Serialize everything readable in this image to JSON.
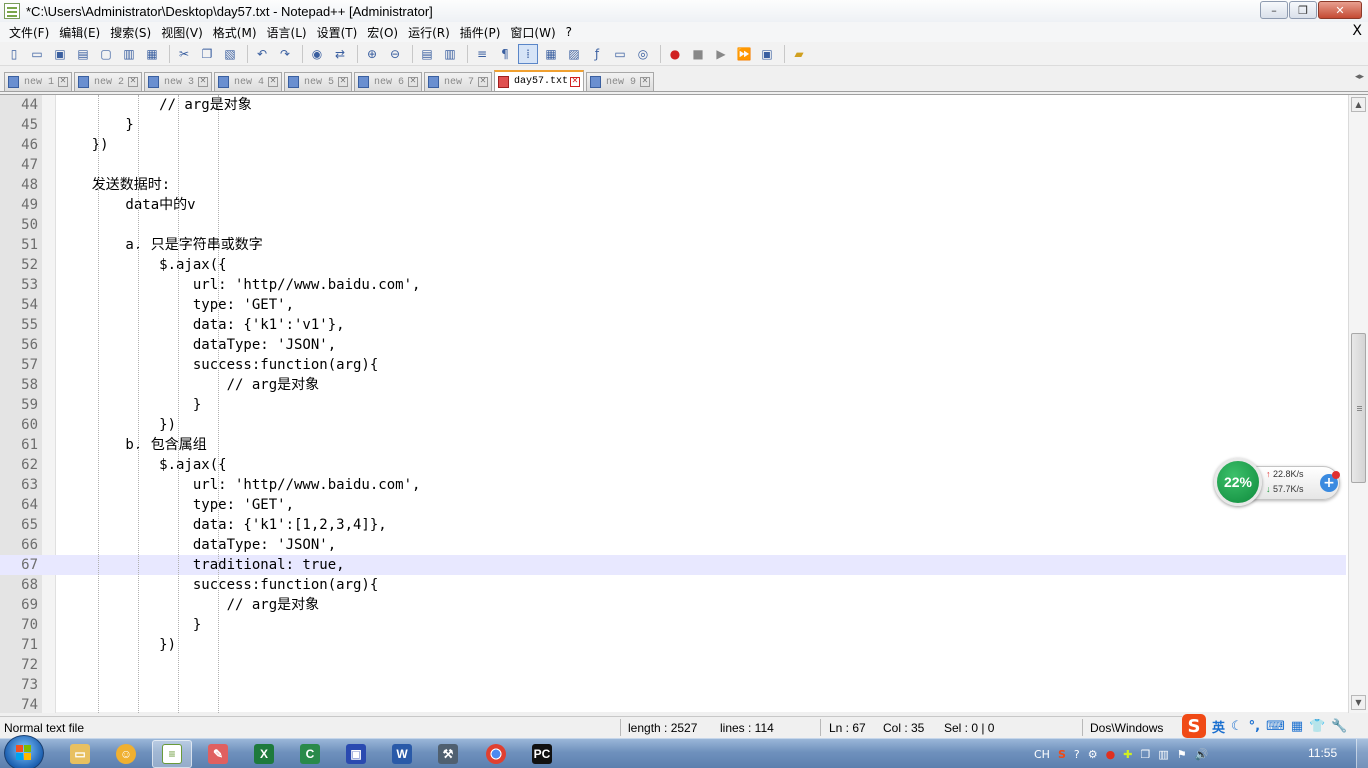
{
  "window": {
    "title": "*C:\\Users\\Administrator\\Desktop\\day57.txt - Notepad++ [Administrator]",
    "minimize_label": "–",
    "restore_label": "❐",
    "close_label": "✕"
  },
  "menu": {
    "items": [
      "文件(F)",
      "编辑(E)",
      "搜索(S)",
      "视图(V)",
      "格式(M)",
      "语言(L)",
      "设置(T)",
      "宏(O)",
      "运行(R)",
      "插件(P)",
      "窗口(W)",
      "?"
    ],
    "close_label": "X"
  },
  "toolbar": {
    "icons": [
      "new-file-icon",
      "open-file-icon",
      "save-icon",
      "save-all-icon",
      "close-file-icon",
      "close-all-icon",
      "print-icon",
      "cut-icon",
      "copy-icon",
      "paste-icon",
      "undo-icon",
      "redo-icon",
      "find-icon",
      "replace-icon",
      "zoom-in-icon",
      "zoom-out-icon",
      "sync-v-icon",
      "sync-h-icon",
      "word-wrap-icon",
      "show-all-chars-icon",
      "indent-guide-icon",
      "udl-icon",
      "doc-map-icon",
      "function-list-icon",
      "folder-workspace-icon",
      "monitor-icon",
      "record-macro-icon",
      "stop-record-icon",
      "play-macro-icon",
      "run-macro-multiple-icon",
      "save-macro-icon",
      "plugin-icon"
    ]
  },
  "tabs": [
    {
      "label": "new 1",
      "active": false
    },
    {
      "label": "new 2",
      "active": false
    },
    {
      "label": "new 3",
      "active": false
    },
    {
      "label": "new 4",
      "active": false
    },
    {
      "label": "new 5",
      "active": false
    },
    {
      "label": "new 6",
      "active": false
    },
    {
      "label": "new 7",
      "active": false
    },
    {
      "label": "day57.txt",
      "active": true
    },
    {
      "label": "new 9",
      "active": false
    }
  ],
  "editor": {
    "current_line": 67,
    "lines": [
      {
        "n": "44",
        "text": "            // arg是对象"
      },
      {
        "n": "45",
        "text": "        }"
      },
      {
        "n": "46",
        "text": "    })"
      },
      {
        "n": "47",
        "text": ""
      },
      {
        "n": "48",
        "text": "    发送数据时:"
      },
      {
        "n": "49",
        "text": "        data中的v"
      },
      {
        "n": "50",
        "text": ""
      },
      {
        "n": "51",
        "text": "        a. 只是字符串或数字"
      },
      {
        "n": "52",
        "text": "            $.ajax({"
      },
      {
        "n": "53",
        "text": "                url: 'http//www.baidu.com',"
      },
      {
        "n": "54",
        "text": "                type: 'GET',"
      },
      {
        "n": "55",
        "text": "                data: {'k1':'v1'},"
      },
      {
        "n": "56",
        "text": "                dataType: 'JSON',"
      },
      {
        "n": "57",
        "text": "                success:function(arg){"
      },
      {
        "n": "58",
        "text": "                    // arg是对象"
      },
      {
        "n": "59",
        "text": "                }"
      },
      {
        "n": "60",
        "text": "            })"
      },
      {
        "n": "61",
        "text": "        b. 包含属组"
      },
      {
        "n": "62",
        "text": "            $.ajax({"
      },
      {
        "n": "63",
        "text": "                url: 'http//www.baidu.com',"
      },
      {
        "n": "64",
        "text": "                type: 'GET',"
      },
      {
        "n": "65",
        "text": "                data: {'k1':[1,2,3,4]},"
      },
      {
        "n": "66",
        "text": "                dataType: 'JSON',"
      },
      {
        "n": "67",
        "text": "                traditional: true,"
      },
      {
        "n": "68",
        "text": "                success:function(arg){"
      },
      {
        "n": "69",
        "text": "                    // arg是对象"
      },
      {
        "n": "70",
        "text": "                }"
      },
      {
        "n": "71",
        "text": "            })"
      },
      {
        "n": "72",
        "text": ""
      },
      {
        "n": "73",
        "text": ""
      },
      {
        "n": "74",
        "text": ""
      }
    ]
  },
  "statusbar": {
    "file_type": "Normal text file",
    "length": "length : 2527",
    "lines": "lines : 114",
    "ln": "Ln : 67",
    "col": "Col : 35",
    "sel": "Sel : 0 | 0",
    "eol": "Dos\\Windows"
  },
  "ime": {
    "logo": "S",
    "lang": "英"
  },
  "net_widget": {
    "percent": "22%",
    "upload": "22.8K/s",
    "download": "57.7K/s"
  },
  "taskbar": {
    "apps": [
      "explorer-icon",
      "pinyin-tool-icon",
      "notepadpp-icon",
      "paint-icon",
      "excel-icon",
      "c-icon",
      "floppy-icon",
      "word-icon",
      "tool-icon",
      "chrome-icon",
      "pycharm-icon"
    ],
    "tray_lang": "CH",
    "clock": "11:55"
  },
  "colors": {
    "current_line": "#e8e8ff",
    "gutter": "#e4e4e4",
    "active_tab_accent": "#f0a030",
    "net_green": "#1a9a3a"
  }
}
